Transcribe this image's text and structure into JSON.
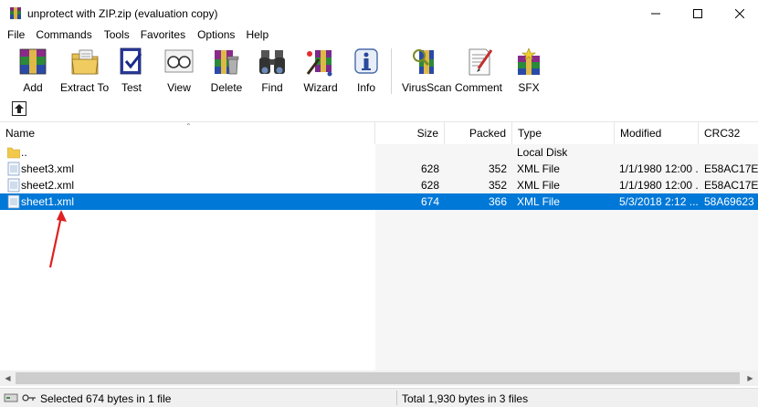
{
  "window": {
    "title": "unprotect with ZIP.zip (evaluation copy)"
  },
  "menu": [
    "File",
    "Commands",
    "Tools",
    "Favorites",
    "Options",
    "Help"
  ],
  "toolbar": {
    "buttons": [
      {
        "label": "Add",
        "icon": "add-archive-icon"
      },
      {
        "label": "Extract To",
        "icon": "extract-folder-icon"
      },
      {
        "label": "Test",
        "icon": "test-icon"
      },
      {
        "label": "View",
        "icon": "view-glasses-icon"
      },
      {
        "label": "Delete",
        "icon": "delete-icon"
      },
      {
        "label": "Find",
        "icon": "binoculars-icon"
      },
      {
        "label": "Wizard",
        "icon": "wizard-icon"
      },
      {
        "label": "Info",
        "icon": "info-icon"
      },
      {
        "label": "VirusScan",
        "icon": "virusscan-icon"
      },
      {
        "label": "Comment",
        "icon": "comment-icon"
      },
      {
        "label": "SFX",
        "icon": "sfx-icon"
      }
    ]
  },
  "columns": [
    "Name",
    "Size",
    "Packed",
    "Type",
    "Modified",
    "CRC32"
  ],
  "files": [
    {
      "name": "..",
      "size": "",
      "packed": "",
      "type": "Local Disk",
      "modified": "",
      "crc": "",
      "kind": "folder",
      "selected": false
    },
    {
      "name": "sheet3.xml",
      "size": "628",
      "packed": "352",
      "type": "XML File",
      "modified": "1/1/1980 12:00 ...",
      "crc": "E58AC17E",
      "kind": "file",
      "selected": false
    },
    {
      "name": "sheet2.xml",
      "size": "628",
      "packed": "352",
      "type": "XML File",
      "modified": "1/1/1980 12:00 ...",
      "crc": "E58AC17E",
      "kind": "file",
      "selected": false
    },
    {
      "name": "sheet1.xml",
      "size": "674",
      "packed": "366",
      "type": "XML File",
      "modified": "5/3/2018 2:12 ...",
      "crc": "58A69623",
      "kind": "file",
      "selected": true
    }
  ],
  "status": {
    "left": "Selected 674 bytes in 1 file",
    "right": "Total 1,930 bytes in 3 files"
  },
  "colors": {
    "selection": "#0078d7",
    "annotation_arrow": "#e02020"
  }
}
